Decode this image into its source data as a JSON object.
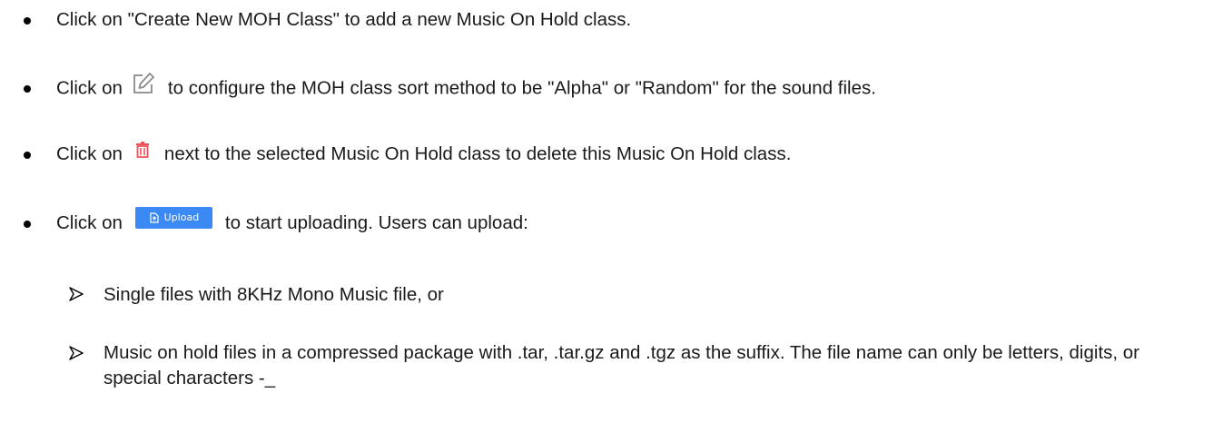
{
  "bullets": [
    {
      "pre": "Click on \"Create New MOH Class\" to add a new Music On Hold class."
    },
    {
      "pre": "Click on",
      "icon": "edit-icon",
      "post": "to configure the MOH class sort method to be \"Alpha\" or \"Random\" for the sound files."
    },
    {
      "pre": "Click on",
      "icon": "trash-icon",
      "post": "next to the selected Music On Hold class to delete this Music On Hold class."
    },
    {
      "pre": "Click on",
      "button_label": "Upload",
      "button_icon": "upload-icon",
      "post": "to start uploading. Users can upload:"
    }
  ],
  "sub_items": [
    {
      "icon": "arrow-bullet-icon",
      "text": "Single files with 8KHz Mono Music file, or"
    },
    {
      "icon": "arrow-bullet-icon",
      "text": "Music on hold files in a compressed package with .tar, .tar.gz and .tgz as the suffix. The file name can only be letters, digits, or special characters -_"
    }
  ],
  "colors": {
    "text": "#1a1a1a",
    "edit_icon": "#8a8a8a",
    "trash_icon": "#f0505a",
    "upload_button": "#3b89f5"
  }
}
